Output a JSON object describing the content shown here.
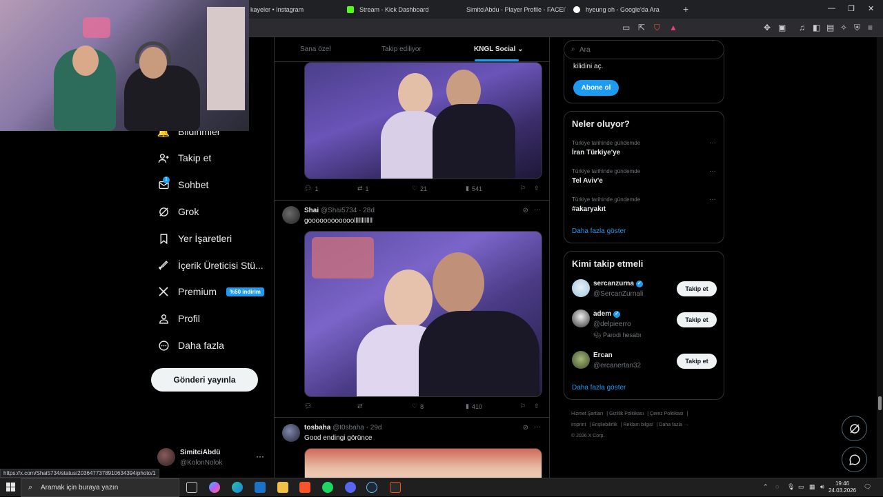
{
  "browser": {
    "tabs": [
      {
        "title": "kayeler • Instagram",
        "color": "#e1306c"
      },
      {
        "title": "Stream - Kick Dashboard",
        "color": "#53fc18"
      },
      {
        "title": "SimitciAbdu - Player Profile - FACEIT",
        "color": "#ff5500"
      },
      {
        "title": "hyeung oh - Google'da Ara",
        "color": "#4285f4"
      }
    ],
    "new_tab": "+",
    "window_controls": [
      "—",
      "❐",
      "✕"
    ]
  },
  "feed_tabs": [
    {
      "label": "Sana özel"
    },
    {
      "label": "Takip ediliyor"
    },
    {
      "label": "KNGL Social"
    }
  ],
  "nav": {
    "items": [
      {
        "label": "Bildirimler",
        "icon": "bell-icon"
      },
      {
        "label": "Takip et",
        "icon": "follow-icon"
      },
      {
        "label": "Sohbet",
        "icon": "chat-icon"
      },
      {
        "label": "Grok",
        "icon": "grok-icon"
      },
      {
        "label": "Yer İşaretleri",
        "icon": "bookmark-icon"
      },
      {
        "label": "İçerik Üreticisi Stü...",
        "icon": "rocket-icon"
      },
      {
        "label": "Premium",
        "icon": "x-logo-icon"
      },
      {
        "label": "Profil",
        "icon": "profile-icon"
      },
      {
        "label": "Daha fazla",
        "icon": "more-circle-icon"
      }
    ],
    "premium_badge": "%50 indirim",
    "chat_badge": "1",
    "post_button": "Gönderi yayınla",
    "account": {
      "name": "SimitciAbdü",
      "handle": "@KolonNolok",
      "more": "···"
    }
  },
  "status_url": "https://x.com/Shai5734/status/2036477378910634394/photo/1",
  "posts": [
    {
      "actions": {
        "replies": "1",
        "reposts": "1",
        "likes": "21",
        "views": "541"
      }
    },
    {
      "name": "Shai",
      "handle": "@Shai5734",
      "time": "28d",
      "text": "goooooooooooollllllllllll",
      "actions": {
        "replies": "",
        "reposts": "",
        "likes": "8",
        "views": "410"
      }
    },
    {
      "name": "tosbaha",
      "handle": "@t0sbaha",
      "time": "29d",
      "text": "Good endingi görünce"
    }
  ],
  "right": {
    "search_placeholder": "Ara",
    "premium": {
      "text": "kilidini aç.",
      "button": "Abone ol"
    },
    "trends": {
      "title": "Neler oluyor?",
      "items": [
        {
          "category": "Türkiye tarihinde gündemde",
          "name": "İran Türkiye'ye"
        },
        {
          "category": "Türkiye tarihinde gündemde",
          "name": "Tel Aviv'e"
        },
        {
          "category": "Türkiye tarihinde gündemde",
          "name": "#akaryakıt"
        }
      ],
      "more": "Daha fazla göster"
    },
    "who_to_follow": {
      "title": "Kimi takip etmeli",
      "users": [
        {
          "name": "sercanzurna",
          "handle": "@SercanZurnali",
          "verified": true,
          "parody": "",
          "button": "Takip et"
        },
        {
          "name": "adem",
          "handle": "@delpieerro",
          "verified": true,
          "parody": "Parodi hesabı",
          "button": "Takip et"
        },
        {
          "name": "Ercan",
          "handle": "@ercanertan32",
          "verified": false,
          "parody": "",
          "button": "Takip et"
        }
      ],
      "more": "Daha fazla göster"
    },
    "footer": [
      "Hizmet Şartları",
      "Gizlilik Politikası",
      "Çerez Politikası",
      "Imprint",
      "Erişilebilirlik",
      "Reklam bilgisi",
      "Daha fazla ···",
      "© 2026 X Corp."
    ]
  },
  "taskbar": {
    "search_placeholder": "Aramak için buraya yazın",
    "time": "19:46",
    "date": "24.03.2026"
  },
  "colors": {
    "accent": "#1d9bf0",
    "background": "#000000",
    "border": "#2f3336"
  }
}
